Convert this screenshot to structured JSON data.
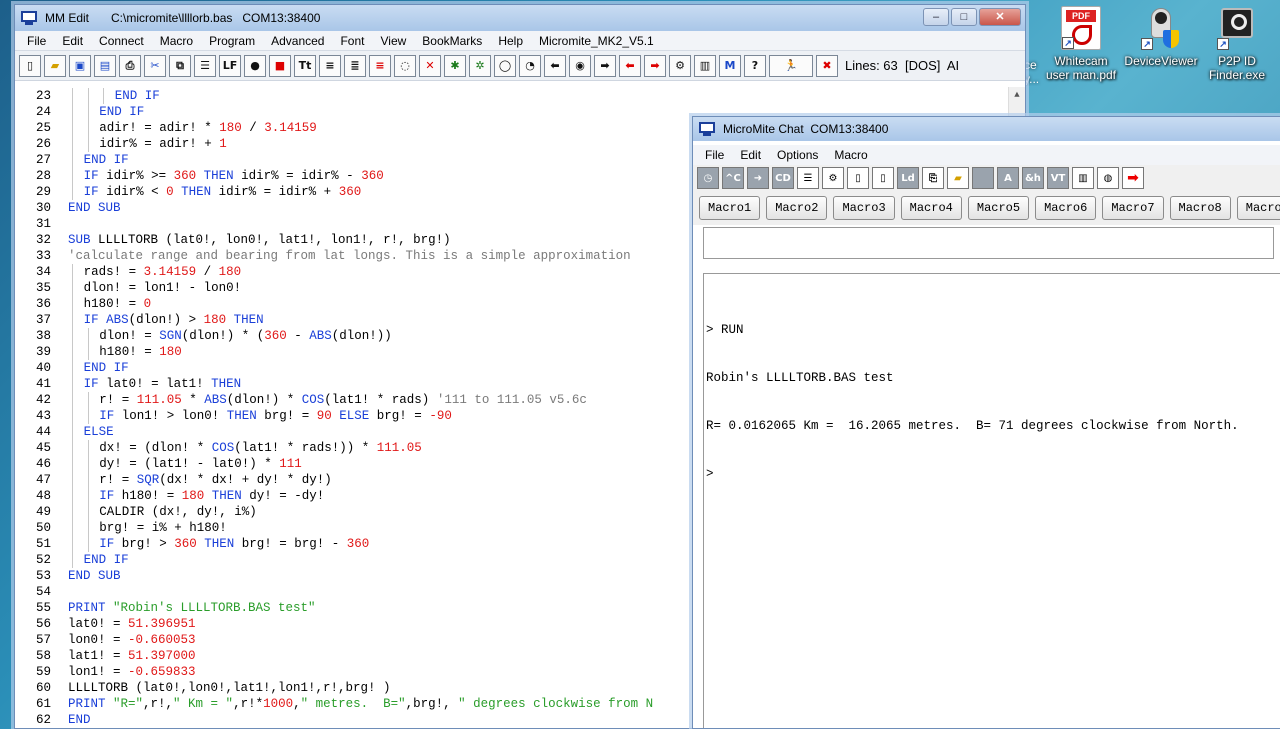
{
  "desktop": {
    "icons": [
      {
        "label1": "Whitecam",
        "label2": "user man.pdf"
      },
      {
        "label1": "DeviceViewer",
        "label2": ""
      },
      {
        "label1": "P2P ID",
        "label2": "Finder.exe"
      }
    ],
    "partial_label1": "ce",
    "partial_label2": "y..."
  },
  "editor_window": {
    "app_name": "MM Edit",
    "file_path": "C:\\micromite\\llllorb.bas",
    "port": "COM13:38400",
    "controls": {
      "minimize": "–",
      "maximize": "□",
      "close": "✕"
    },
    "menu": [
      "File",
      "Edit",
      "Connect",
      "Macro",
      "Program",
      "Advanced",
      "Font",
      "View",
      "BookMarks",
      "Help",
      "Micromite_MK2_V5.1"
    ],
    "status": "Lines: 63  [DOS]  AI",
    "lines": [
      {
        "n": "23",
        "indent": 3,
        "t": [
          [
            "kw",
            "END IF"
          ]
        ]
      },
      {
        "n": "24",
        "indent": 2,
        "t": [
          [
            "kw",
            "END IF"
          ]
        ]
      },
      {
        "n": "25",
        "indent": 2,
        "t": [
          [
            "pl",
            "adir! = adir! * "
          ],
          [
            "num",
            "180"
          ],
          [
            "pl",
            " / "
          ],
          [
            "num",
            "3.14159"
          ]
        ]
      },
      {
        "n": "26",
        "indent": 2,
        "t": [
          [
            "pl",
            "idir% = adir! + "
          ],
          [
            "num",
            "1"
          ]
        ]
      },
      {
        "n": "27",
        "indent": 1,
        "t": [
          [
            "kw",
            "END IF"
          ]
        ]
      },
      {
        "n": "28",
        "indent": 1,
        "t": [
          [
            "kw",
            "IF"
          ],
          [
            "pl",
            " idir% >= "
          ],
          [
            "num",
            "360"
          ],
          [
            "kw",
            " THEN"
          ],
          [
            "pl",
            " idir% = idir% - "
          ],
          [
            "num",
            "360"
          ]
        ]
      },
      {
        "n": "29",
        "indent": 1,
        "t": [
          [
            "kw",
            "IF"
          ],
          [
            "pl",
            " idir% < "
          ],
          [
            "num",
            "0"
          ],
          [
            "kw",
            " THEN"
          ],
          [
            "pl",
            " idir% = idir% + "
          ],
          [
            "num",
            "360"
          ]
        ]
      },
      {
        "n": "30",
        "indent": 0,
        "t": [
          [
            "kw",
            "END SUB"
          ]
        ]
      },
      {
        "n": "31",
        "indent": 0,
        "t": []
      },
      {
        "n": "32",
        "indent": 0,
        "t": [
          [
            "kw",
            "SUB"
          ],
          [
            "pl",
            " LLLLTORB (lat0!, lon0!, lat1!, lon1!, r!, brg!)"
          ]
        ]
      },
      {
        "n": "33",
        "indent": 0,
        "t": [
          [
            "com",
            "'calculate range and bearing from lat longs. This is a simple approximation"
          ]
        ]
      },
      {
        "n": "34",
        "indent": 1,
        "t": [
          [
            "pl",
            "rads! = "
          ],
          [
            "num",
            "3.14159"
          ],
          [
            "pl",
            " / "
          ],
          [
            "num",
            "180"
          ]
        ]
      },
      {
        "n": "35",
        "indent": 1,
        "t": [
          [
            "pl",
            "dlon! = lon1! - lon0!"
          ]
        ]
      },
      {
        "n": "36",
        "indent": 1,
        "t": [
          [
            "pl",
            "h180! = "
          ],
          [
            "num",
            "0"
          ]
        ]
      },
      {
        "n": "37",
        "indent": 1,
        "t": [
          [
            "kw",
            "IF"
          ],
          [
            "pl",
            " "
          ],
          [
            "kw",
            "ABS"
          ],
          [
            "pl",
            "(dlon!) > "
          ],
          [
            "num",
            "180"
          ],
          [
            "kw",
            " THEN"
          ]
        ]
      },
      {
        "n": "38",
        "indent": 2,
        "t": [
          [
            "pl",
            "dlon! = "
          ],
          [
            "kw",
            "SGN"
          ],
          [
            "pl",
            "(dlon!) * ("
          ],
          [
            "num",
            "360"
          ],
          [
            "pl",
            " - "
          ],
          [
            "kw",
            "ABS"
          ],
          [
            "pl",
            "(dlon!))"
          ]
        ]
      },
      {
        "n": "39",
        "indent": 2,
        "t": [
          [
            "pl",
            "h180! = "
          ],
          [
            "num",
            "180"
          ]
        ]
      },
      {
        "n": "40",
        "indent": 1,
        "t": [
          [
            "kw",
            "END IF"
          ]
        ]
      },
      {
        "n": "41",
        "indent": 1,
        "t": [
          [
            "kw",
            "IF"
          ],
          [
            "pl",
            " lat0! = lat1! "
          ],
          [
            "kw",
            "THEN"
          ]
        ]
      },
      {
        "n": "42",
        "indent": 2,
        "t": [
          [
            "pl",
            "r! = "
          ],
          [
            "num",
            "111.05"
          ],
          [
            "pl",
            " * "
          ],
          [
            "kw",
            "ABS"
          ],
          [
            "pl",
            "(dlon!) * "
          ],
          [
            "kw",
            "COS"
          ],
          [
            "pl",
            "(lat1! * rads) "
          ],
          [
            "com",
            "'111 to 111.05 v5.6c"
          ]
        ]
      },
      {
        "n": "43",
        "indent": 2,
        "t": [
          [
            "kw",
            "IF"
          ],
          [
            "pl",
            " lon1! > lon0! "
          ],
          [
            "kw",
            "THEN"
          ],
          [
            "pl",
            " brg! = "
          ],
          [
            "num",
            "90"
          ],
          [
            "kw",
            " ELSE"
          ],
          [
            "pl",
            " brg! = "
          ],
          [
            "num",
            "-90"
          ]
        ]
      },
      {
        "n": "44",
        "indent": 1,
        "t": [
          [
            "kw",
            "ELSE"
          ]
        ]
      },
      {
        "n": "45",
        "indent": 2,
        "t": [
          [
            "pl",
            "dx! = (dlon! * "
          ],
          [
            "kw",
            "COS"
          ],
          [
            "pl",
            "(lat1! * rads!)) * "
          ],
          [
            "num",
            "111.05"
          ]
        ]
      },
      {
        "n": "46",
        "indent": 2,
        "t": [
          [
            "pl",
            "dy! = (lat1! - lat0!) * "
          ],
          [
            "num",
            "111"
          ]
        ]
      },
      {
        "n": "47",
        "indent": 2,
        "t": [
          [
            "pl",
            "r! = "
          ],
          [
            "kw",
            "SQR"
          ],
          [
            "pl",
            "(dx! * dx! + dy! * dy!)"
          ]
        ]
      },
      {
        "n": "48",
        "indent": 2,
        "t": [
          [
            "kw",
            "IF"
          ],
          [
            "pl",
            " h180! = "
          ],
          [
            "num",
            "180"
          ],
          [
            "kw",
            " THEN"
          ],
          [
            "pl",
            " dy! = -dy!"
          ]
        ]
      },
      {
        "n": "49",
        "indent": 2,
        "t": [
          [
            "pl",
            "CALDIR (dx!, dy!, i%)"
          ]
        ]
      },
      {
        "n": "50",
        "indent": 2,
        "t": [
          [
            "pl",
            "brg! = i% + h180!"
          ]
        ]
      },
      {
        "n": "51",
        "indent": 2,
        "t": [
          [
            "kw",
            "IF"
          ],
          [
            "pl",
            " brg! > "
          ],
          [
            "num",
            "360"
          ],
          [
            "kw",
            " THEN"
          ],
          [
            "pl",
            " brg! = brg! - "
          ],
          [
            "num",
            "360"
          ]
        ]
      },
      {
        "n": "52",
        "indent": 1,
        "t": [
          [
            "kw",
            "END IF"
          ]
        ]
      },
      {
        "n": "53",
        "indent": 0,
        "t": [
          [
            "kw",
            "END SUB"
          ]
        ]
      },
      {
        "n": "54",
        "indent": 0,
        "t": []
      },
      {
        "n": "55",
        "indent": 0,
        "t": [
          [
            "kw",
            "PRINT"
          ],
          [
            "str",
            " \"Robin's LLLLTORB.BAS test\""
          ]
        ]
      },
      {
        "n": "56",
        "indent": 0,
        "t": [
          [
            "pl",
            "lat0! = "
          ],
          [
            "num",
            "51.396951"
          ]
        ]
      },
      {
        "n": "57",
        "indent": 0,
        "t": [
          [
            "pl",
            "lon0! = "
          ],
          [
            "num",
            "-0.660053"
          ]
        ]
      },
      {
        "n": "58",
        "indent": 0,
        "t": [
          [
            "pl",
            "lat1! = "
          ],
          [
            "num",
            "51.397000"
          ]
        ]
      },
      {
        "n": "59",
        "indent": 0,
        "t": [
          [
            "pl",
            "lon1! = "
          ],
          [
            "num",
            "-0.659833"
          ]
        ]
      },
      {
        "n": "60",
        "indent": 0,
        "t": [
          [
            "pl",
            "LLLLTORB (lat0!,lon0!,lat1!,lon1!,r!,brg! )"
          ]
        ]
      },
      {
        "n": "61",
        "indent": 0,
        "t": [
          [
            "kw",
            "PRINT"
          ],
          [
            "str",
            " \"R=\""
          ],
          [
            "pl",
            ",r!,"
          ],
          [
            "str",
            "\" Km = \""
          ],
          [
            "pl",
            ",r!*"
          ],
          [
            "num",
            "1000"
          ],
          [
            "pl",
            ","
          ],
          [
            "str",
            "\" metres.  B=\""
          ],
          [
            "pl",
            ",brg!, "
          ],
          [
            "str",
            "\" degrees clockwise from N"
          ]
        ]
      },
      {
        "n": "62",
        "indent": 0,
        "t": [
          [
            "kw",
            "END"
          ]
        ]
      },
      {
        "n": "63",
        "indent": 0,
        "t": []
      }
    ]
  },
  "chat_window": {
    "title": "MicroMite Chat  COM13:38400",
    "menu": [
      "File",
      "Edit",
      "Options",
      "Macro"
    ],
    "macros": [
      "Macro1",
      "Macro2",
      "Macro3",
      "Macro4",
      "Macro5",
      "Macro6",
      "Macro7",
      "Macro8",
      "Macro9",
      "M"
    ],
    "send_value": "",
    "terminal_lines": [
      "> RUN",
      "Robin's LLLLTORB.BAS test",
      "R= 0.0162065 Km =  16.2065 metres.  B= 71 degrees clockwise from North.",
      ">"
    ]
  },
  "colors": {
    "keyword": "#1a3fd8",
    "number": "#e01818",
    "string": "#2a9d2a",
    "comment": "#7a7a7a"
  }
}
